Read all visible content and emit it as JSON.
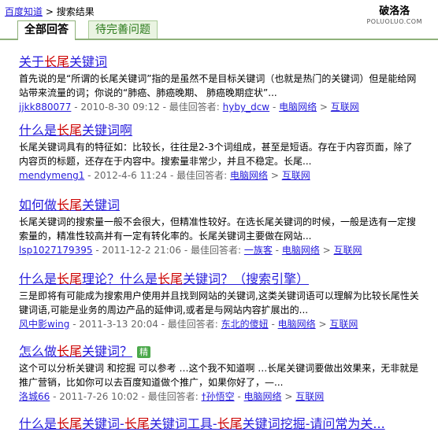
{
  "breadcrumb": {
    "home": "百度知道",
    "sep": " > ",
    "current": "搜索结果"
  },
  "watermark": {
    "cn": "破洛洛",
    "en": "POLUOLUO.COM"
  },
  "tabs": [
    {
      "label": "全部回答"
    },
    {
      "label": "待完善问题"
    }
  ],
  "results": [
    {
      "title": [
        "关于",
        "长尾",
        "关键词"
      ],
      "snippet": "首先说的是“所谓的长尾关键词”指的是虽然不是目标关键词（也就是热门的关键词）但是能给网站带来流量的词；你说的“肺癌、肺癌晚期、 肺癌晚期症状”...",
      "user": "jjkk880077",
      "date": " - 2010-8-30 09:12 - 最佳回答者: ",
      "answerer": "hyby_dcw",
      "cat1": "电脑网络",
      "cat2": "互联网"
    },
    {
      "title": [
        "什么是",
        "长尾",
        "关键词啊"
      ],
      "snippet": "长尾关键词具有的特征如：比较长，往往是2-3个词组成，甚至是短语。存在于内容页面，除了内容页的标题，还存在于内容中。搜索量非常少，并且不稳定。长尾...",
      "user": "mendymeng1",
      "date": " - 2012-4-6 11:24 - 最佳回答者: ",
      "answerer": "",
      "cat1": "电脑网络",
      "cat2": "互联网"
    },
    {
      "title": [
        "如何做",
        "长尾",
        "关键词"
      ],
      "snippet": "长尾关键词的搜索量一般不会很大，但精准性较好。在选长尾关键词的时候，一般是选有一定搜索量的，精准性较高并有一定有转化率的。长尾关键词主要做在网站...",
      "user": "lsp1027179395",
      "date": " - 2011-12-2 21:06 - 最佳回答者: ",
      "answerer": "一族客",
      "cat1": "电脑网络",
      "cat2": "互联网"
    },
    {
      "title": [
        "什么是",
        "长尾",
        "理论？什么是",
        "长尾",
        "关键词？（搜索引擎）"
      ],
      "snippet": "三是即将有可能成为搜索用户使用并且找到网站的关键词,这类关键词语可以理解为比较长尾性关键词语,可能是业务的周边产品的延伸词,或者是与网站内容扩展出的...",
      "user": "风中影wing",
      "date": " - 2011-3-13 20:04 - 最佳回答者: ",
      "answerer": "东北的傻妞",
      "cat1": "电脑网络",
      "cat2": "互联网"
    },
    {
      "title": [
        "怎么做",
        "长尾",
        "关键词？"
      ],
      "badge": "精",
      "snippet": "这个可以分析关键词 和挖掘 可以参考 …这个我不知道啊 …长尾关键词要做出效果来，无非就是推广营销，比如你可以去百度知道做个推广，如果你好了，—...",
      "user": "洛城66",
      "date": " - 2011-7-26 10:02 - 最佳回答者: ",
      "answerer": "†孙悟空",
      "cat1": "电脑网络",
      "cat2": "互联网"
    },
    {
      "title": [
        "什么是",
        "长尾",
        "关键词-",
        "长尾",
        "关键词工具-",
        "长尾",
        "关键词挖掘-请问常为关..."
      ]
    }
  ]
}
